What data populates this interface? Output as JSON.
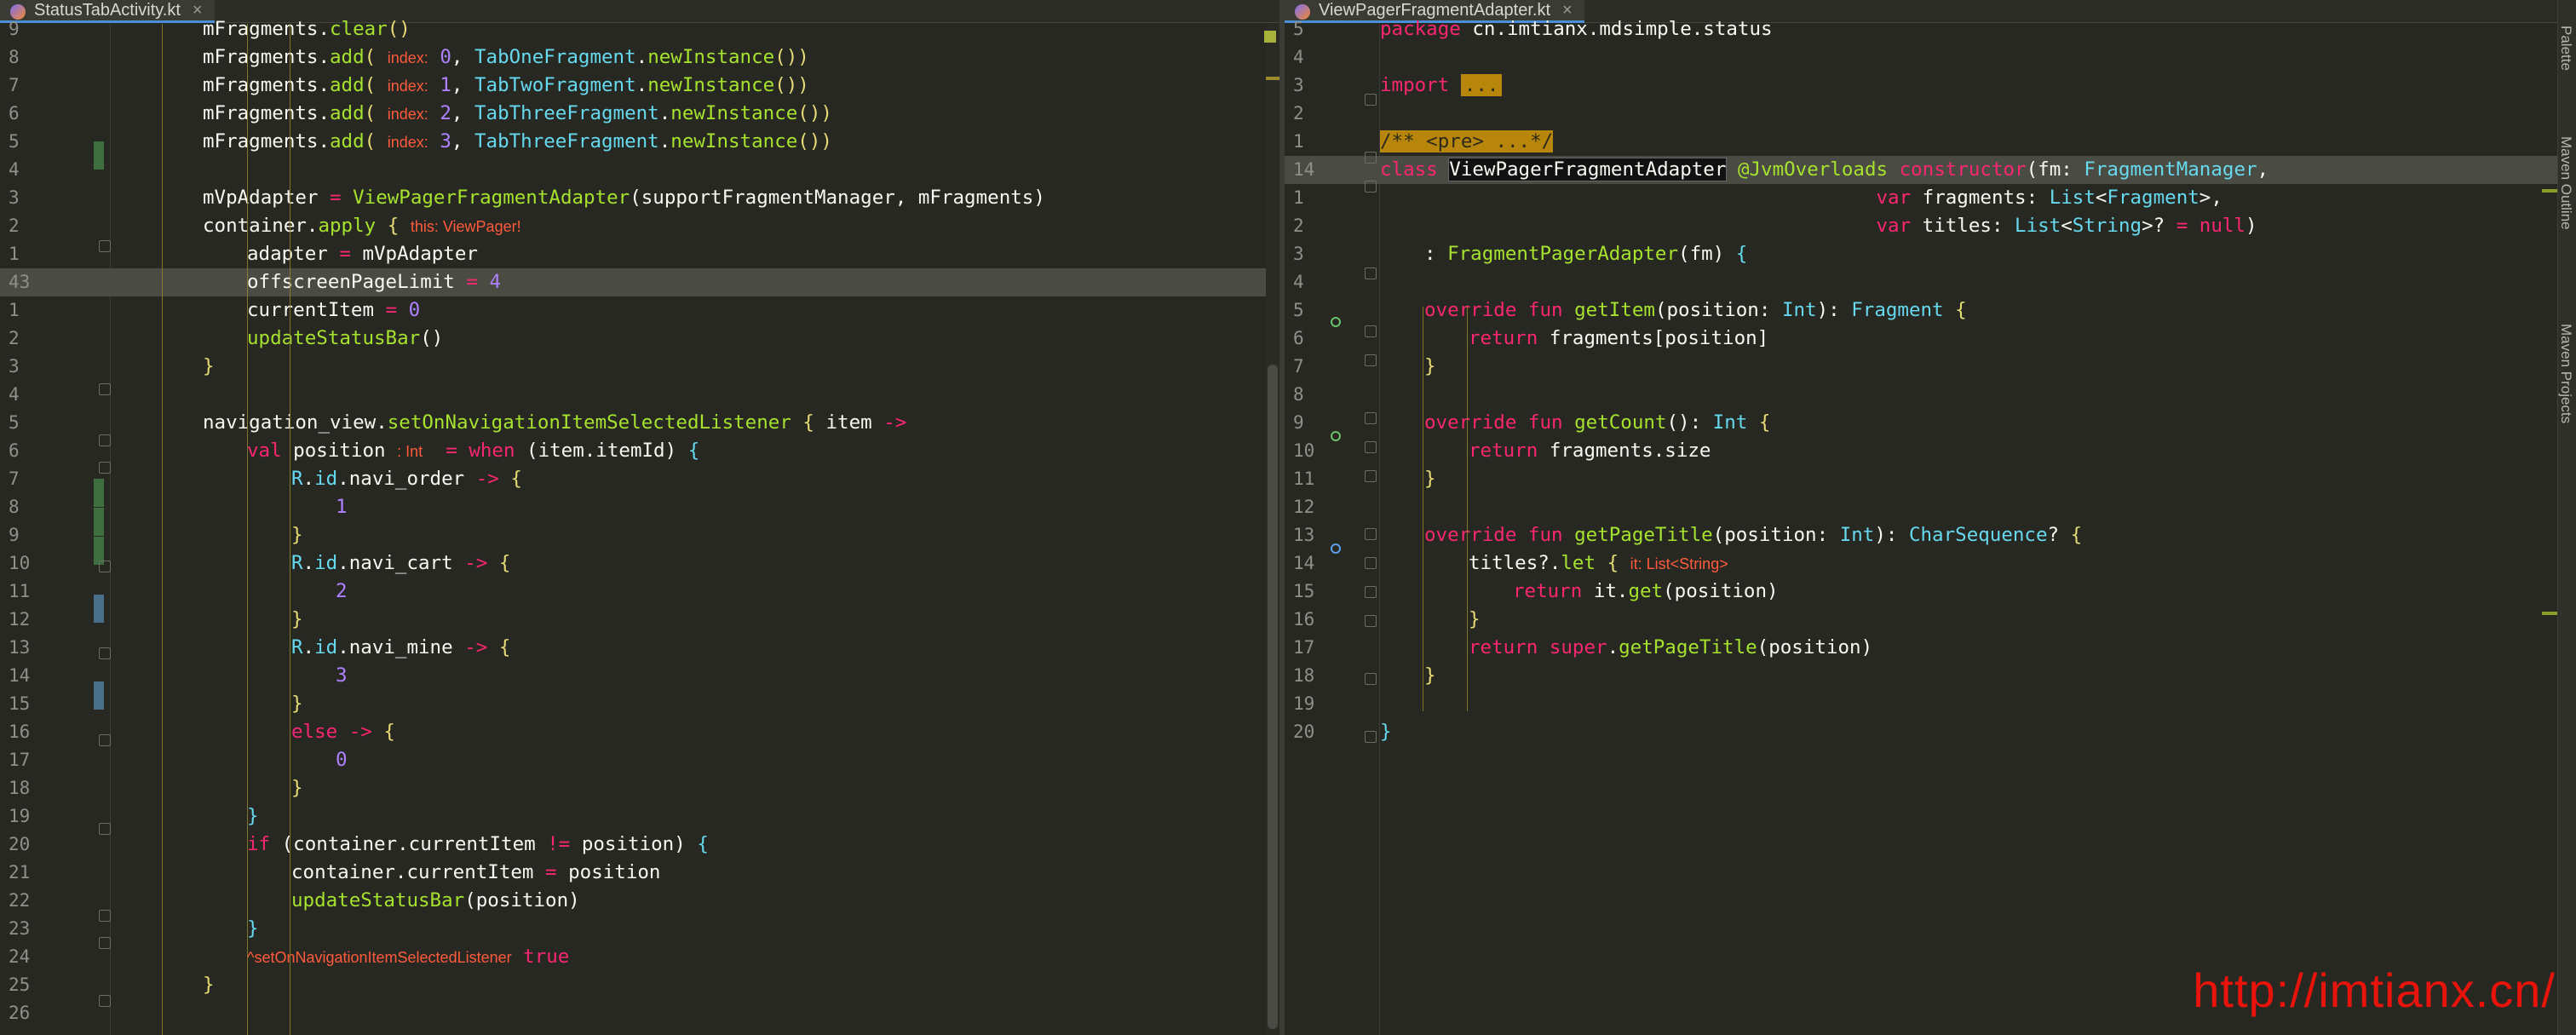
{
  "left": {
    "tab_label": "StatusTabActivity.kt",
    "lines": [
      {
        "ln": "9",
        "indent": 0,
        "html": "mFragments.<span class='fn'>clear</span><span class='br'>()</span>"
      },
      {
        "ln": "8",
        "indent": 0,
        "html": "mFragments.<span class='fn'>add</span><span class='br'>(</span> <span class='hint'>index:</span> <span class='num'>0</span>, <span class='ty'>TabOneFragment</span>.<span class='fn'>newInstance</span><span class='br'>())</span>"
      },
      {
        "ln": "7",
        "indent": 0,
        "html": "mFragments.<span class='fn'>add</span><span class='br'>(</span> <span class='hint'>index:</span> <span class='num'>1</span>, <span class='ty'>TabTwoFragment</span>.<span class='fn'>newInstance</span><span class='br'>())</span>"
      },
      {
        "ln": "6",
        "indent": 0,
        "html": "mFragments.<span class='fn'>add</span><span class='br'>(</span> <span class='hint'>index:</span> <span class='num'>2</span>, <span class='ty'>TabThreeFragment</span>.<span class='fn'>newInstance</span><span class='br'>())</span>"
      },
      {
        "ln": "5",
        "indent": 0,
        "html": "mFragments.<span class='fn'>add</span><span class='br'>(</span> <span class='hint'>index:</span> <span class='num'>3</span>, <span class='ty'>TabThreeFragment</span>.<span class='fn'>newInstance</span><span class='br'>())</span>"
      },
      {
        "ln": "4",
        "indent": 0,
        "html": ""
      },
      {
        "ln": "3",
        "indent": 0,
        "html": "mVpAdapter <span class='op'>=</span> <span class='fn'>ViewPagerFragmentAdapter</span>(supportFragmentManager, mFragments)"
      },
      {
        "ln": "2",
        "indent": 0,
        "html": "container.<span class='fn'>apply</span> <span class='br'>{</span> <span class='hint'>this: ViewPager!</span>"
      },
      {
        "ln": "1",
        "indent": 1,
        "html": "adapter <span class='op'>=</span> mVpAdapter"
      },
      {
        "ln": "43",
        "indent": 1,
        "html": "offscreenPageLimit <span class='op'>=</span> <span class='num'>4</span>",
        "hl": true
      },
      {
        "ln": "1",
        "indent": 1,
        "html": "currentItem <span class='op'>=</span> <span class='num'>0</span>"
      },
      {
        "ln": "2",
        "indent": 1,
        "html": "<span class='fn'>updateStatusBar</span>()"
      },
      {
        "ln": "3",
        "indent": 0,
        "html": "<span class='br'>}</span>"
      },
      {
        "ln": "4",
        "indent": 0,
        "html": ""
      },
      {
        "ln": "5",
        "indent": 0,
        "html": "navigation_view.<span class='fn'>setOnNavigationItemSelectedListener</span> <span class='br'>{</span> item <span class='op'>-&gt;</span>"
      },
      {
        "ln": "6",
        "indent": 1,
        "html": "<span class='kw'>val</span> position <span class='hint'>: Int</span>  <span class='op'>=</span> <span class='kw'>when</span> (item.itemId) <span class='ty'>{</span>"
      },
      {
        "ln": "7",
        "indent": 2,
        "html": "<span class='ty'>R</span>.<span class='ty'>id</span>.navi_order <span class='op'>-&gt;</span> <span class='br'>{</span>"
      },
      {
        "ln": "8",
        "indent": 3,
        "html": "<span class='num'>1</span>"
      },
      {
        "ln": "9",
        "indent": 2,
        "html": "<span class='br'>}</span>"
      },
      {
        "ln": "10",
        "indent": 2,
        "html": "<span class='ty'>R</span>.<span class='ty'>id</span>.navi_cart <span class='op'>-&gt;</span> <span class='br'>{</span>"
      },
      {
        "ln": "11",
        "indent": 3,
        "html": "<span class='num'>2</span>"
      },
      {
        "ln": "12",
        "indent": 2,
        "html": "<span class='br'>}</span>"
      },
      {
        "ln": "13",
        "indent": 2,
        "html": "<span class='ty'>R</span>.<span class='ty'>id</span>.navi_mine <span class='op'>-&gt;</span> <span class='br'>{</span>"
      },
      {
        "ln": "14",
        "indent": 3,
        "html": "<span class='num'>3</span>"
      },
      {
        "ln": "15",
        "indent": 2,
        "html": "<span class='br'>}</span>"
      },
      {
        "ln": "16",
        "indent": 2,
        "html": "<span class='kw'>else</span> <span class='op'>-&gt;</span> <span class='br'>{</span>"
      },
      {
        "ln": "17",
        "indent": 3,
        "html": "<span class='num'>0</span>"
      },
      {
        "ln": "18",
        "indent": 2,
        "html": "<span class='br'>}</span>"
      },
      {
        "ln": "19",
        "indent": 1,
        "html": "<span class='ty'>}</span>"
      },
      {
        "ln": "20",
        "indent": 1,
        "html": "<span class='kw'>if</span> (container.currentItem <span class='op'>!=</span> position) <span class='ty'>{</span>"
      },
      {
        "ln": "21",
        "indent": 2,
        "html": "container.currentItem <span class='op'>=</span> position"
      },
      {
        "ln": "22",
        "indent": 2,
        "html": "<span class='fn'>updateStatusBar</span>(position)"
      },
      {
        "ln": "23",
        "indent": 1,
        "html": "<span class='ty'>}</span>"
      },
      {
        "ln": "24",
        "indent": 1,
        "html": "<span class='hint'>^setOnNavigationItemSelectedListener</span> <span class='kw'>true</span>"
      },
      {
        "ln": "25",
        "indent": 0,
        "html": "<span class='br'>}</span>"
      },
      {
        "ln": "26",
        "indent": 0,
        "html": ""
      }
    ]
  },
  "right": {
    "tab_label": "ViewPagerFragmentAdapter.kt",
    "lines": [
      {
        "ln": "5",
        "indent": 0,
        "html": "<span class='kw'>package</span> cn.imtianx.mdsimple.status"
      },
      {
        "ln": "4",
        "indent": 0,
        "html": ""
      },
      {
        "ln": "3",
        "indent": 0,
        "html": "<span class='kw'>import</span> <span class='folded'>...</span>"
      },
      {
        "ln": "2",
        "indent": 0,
        "html": ""
      },
      {
        "ln": "1",
        "indent": 0,
        "html": "<span class='pre-fold'>/** &lt;pre&gt; ...*/</span>"
      },
      {
        "ln": "14",
        "indent": 0,
        "html": "<span class='kw'>class</span> <span class='caret-word'>ViewPagerFragmentAdapter</span> <span class='ann'>@JvmOverloads</span> <span class='kw'>constructor</span>(fm: <span class='ty'>FragmentManager</span>,",
        "hl": true
      },
      {
        "ln": "1",
        "indent": 0,
        "html": "                                           <span class='kw'>var</span> fragments: <span class='ty'>List</span>&lt;<span class='ty'>Fragment</span>&gt;,"
      },
      {
        "ln": "2",
        "indent": 0,
        "html": "                                           <span class='kw'>var</span> titles: <span class='ty'>List</span>&lt;<span class='ty'>String</span>&gt;? <span class='op'>=</span> <span class='kw'>null</span>)"
      },
      {
        "ln": "3",
        "indent": 1,
        "html": ": <span class='fn'>FragmentPagerAdapter</span>(fm) <span class='ty'>{</span>"
      },
      {
        "ln": "4",
        "indent": 0,
        "html": ""
      },
      {
        "ln": "5",
        "indent": 1,
        "html": "<span class='kw'>override fun</span> <span class='fn'>getItem</span>(position: <span class='ty'>Int</span>): <span class='ty'>Fragment</span> <span class='br'>{</span>"
      },
      {
        "ln": "6",
        "indent": 2,
        "html": "<span class='kw'>return</span> fragments[position]"
      },
      {
        "ln": "7",
        "indent": 1,
        "html": "<span class='br'>}</span>"
      },
      {
        "ln": "8",
        "indent": 0,
        "html": ""
      },
      {
        "ln": "9",
        "indent": 1,
        "html": "<span class='kw'>override fun</span> <span class='fn'>getCount</span>(): <span class='ty'>Int</span> <span class='br'>{</span>"
      },
      {
        "ln": "10",
        "indent": 2,
        "html": "<span class='kw'>return</span> fragments.size"
      },
      {
        "ln": "11",
        "indent": 1,
        "html": "<span class='br'>}</span>"
      },
      {
        "ln": "12",
        "indent": 0,
        "html": ""
      },
      {
        "ln": "13",
        "indent": 1,
        "html": "<span class='kw'>override fun</span> <span class='fn'>getPageTitle</span>(position: <span class='ty'>Int</span>): <span class='ty'>CharSequence</span>? <span class='br'>{</span>"
      },
      {
        "ln": "14",
        "indent": 2,
        "html": "titles?.<span class='fn'>let</span> <span class='br'>{</span> <span class='hint'>it: List&lt;String&gt;</span>"
      },
      {
        "ln": "15",
        "indent": 3,
        "html": "<span class='kw'>return</span> it.<span class='fn'>get</span>(position)"
      },
      {
        "ln": "16",
        "indent": 2,
        "html": "<span class='br'>}</span>"
      },
      {
        "ln": "17",
        "indent": 2,
        "html": "<span class='kw'>return super</span>.<span class='fn'>getPageTitle</span>(position)"
      },
      {
        "ln": "18",
        "indent": 1,
        "html": "<span class='br'>}</span>"
      },
      {
        "ln": "19",
        "indent": 0,
        "html": ""
      },
      {
        "ln": "20",
        "indent": 0,
        "html": "<span class='ty'>}</span>"
      }
    ]
  },
  "side_panels": {
    "top": "Palette",
    "middle": "Maven Outline",
    "bottom": "Maven Projects"
  },
  "watermark": "http://imtianx.cn/",
  "colors": {
    "background": "#272822",
    "keyword": "#f92672",
    "function": "#a6e22e",
    "type": "#66d9ef",
    "number": "#ae81ff",
    "hint": "#ff5a3d",
    "watermark": "#e8140c"
  }
}
